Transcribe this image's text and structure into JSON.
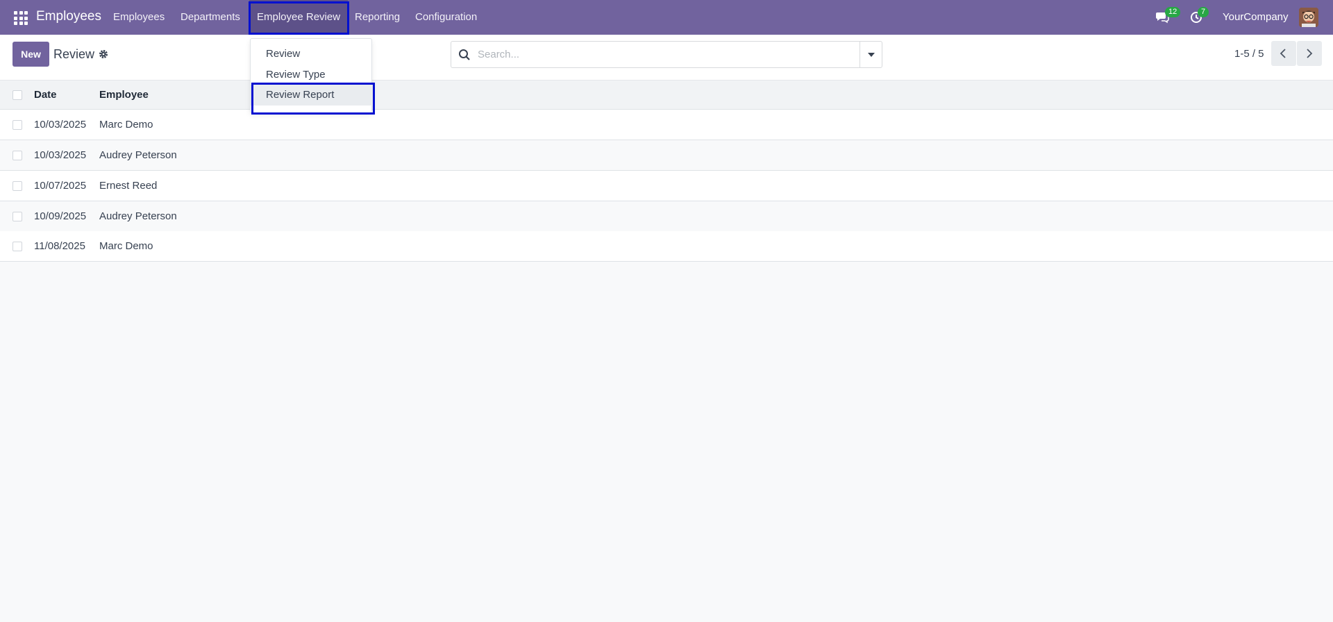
{
  "navbar": {
    "brand": "Employees",
    "menu": [
      "Employees",
      "Departments",
      "Employee Review",
      "Reporting",
      "Configuration"
    ],
    "active_menu": "Employee Review",
    "messages_count": "12",
    "activities_count": "7",
    "company": "YourCompany",
    "color": "#71639e"
  },
  "control_panel": {
    "new_label": "New",
    "title": "Review",
    "search_placeholder": "Search...",
    "pager": "1-5 / 5"
  },
  "dropdown": {
    "items": [
      "Review",
      "Review Type",
      "Review Report"
    ],
    "highlighted": "Review Report"
  },
  "list": {
    "columns": [
      "Date",
      "Employee"
    ],
    "rows": [
      {
        "date": "10/03/2025",
        "employee": "Marc Demo"
      },
      {
        "date": "10/03/2025",
        "employee": "Audrey Peterson"
      },
      {
        "date": "10/07/2025",
        "employee": "Ernest Reed"
      },
      {
        "date": "10/09/2025",
        "employee": "Audrey Peterson"
      },
      {
        "date": "11/08/2025",
        "employee": "Marc Demo"
      }
    ]
  },
  "icons": {
    "apps": "apps-grid-icon",
    "gear": "gear-icon",
    "search": "search-icon",
    "chat": "chat-icon",
    "activity": "clock-icon",
    "prev": "chevron-left-icon",
    "next": "chevron-right-icon"
  }
}
